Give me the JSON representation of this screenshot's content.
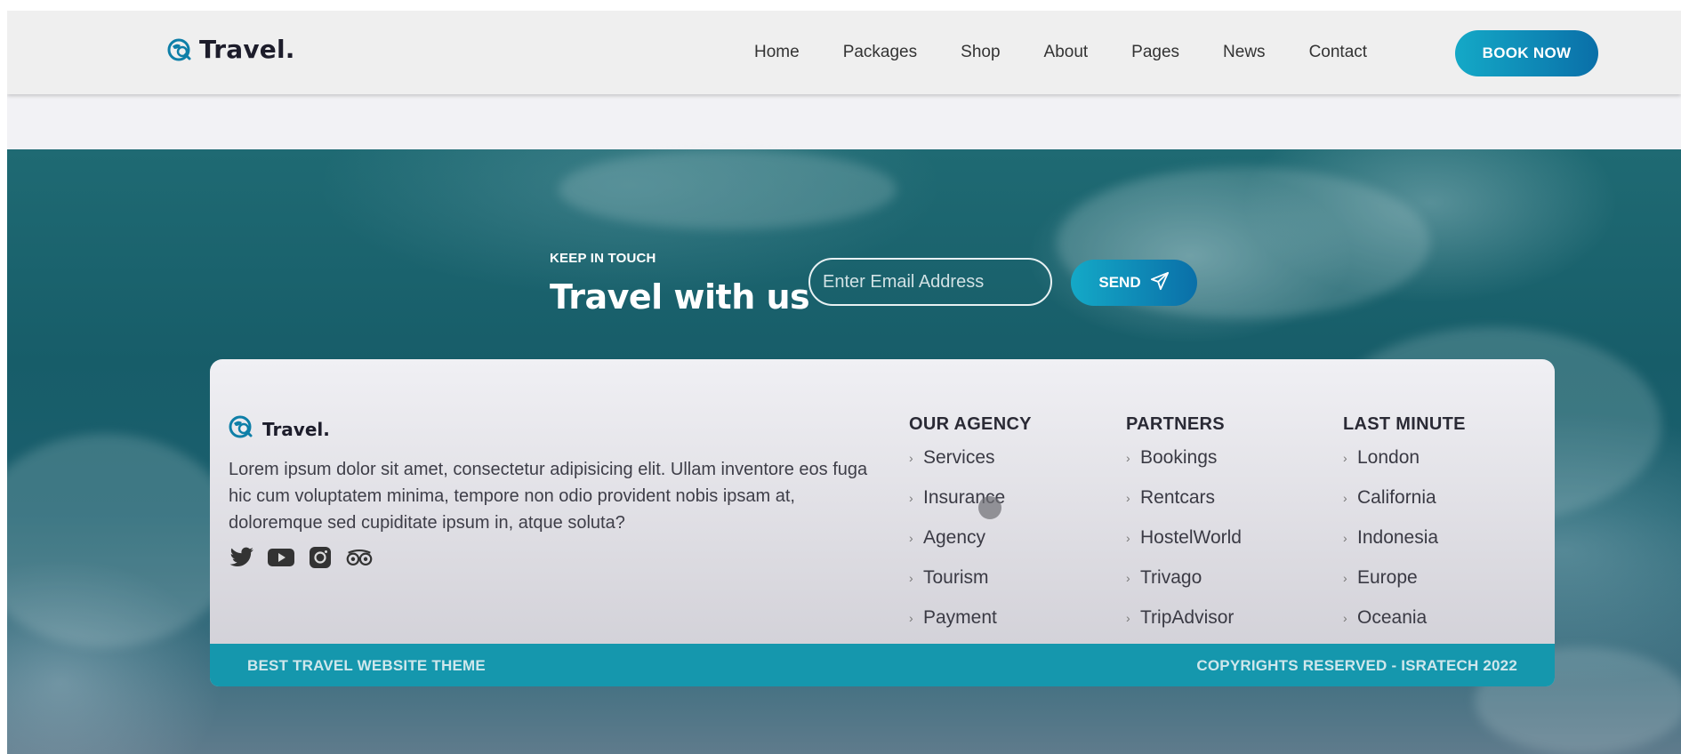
{
  "brand": {
    "name": "Travel."
  },
  "nav": {
    "links": [
      "Home",
      "Packages",
      "Shop",
      "About",
      "Pages",
      "News",
      "Contact"
    ],
    "cta": "BOOK NOW"
  },
  "newsletter": {
    "eyebrow": "KEEP IN TOUCH",
    "heading": "Travel with us",
    "email_placeholder": "Enter Email Address",
    "send_label": "SEND"
  },
  "footer": {
    "brand": "Travel.",
    "about": "Lorem ipsum dolor sit amet, consectetur adipisicing elit. Ullam inventore eos fuga hic cum voluptatem minima, tempore non odio provident nobis ipsam at, doloremque sed cupiditate ipsum in, atque soluta?",
    "social_icons": [
      "twitter-icon",
      "youtube-icon",
      "instagram-icon",
      "tripadvisor-icon"
    ],
    "columns": [
      {
        "title": "OUR AGENCY",
        "items": [
          "Services",
          "Insurance",
          "Agency",
          "Tourism",
          "Payment"
        ]
      },
      {
        "title": "PARTNERS",
        "items": [
          "Bookings",
          "Rentcars",
          "HostelWorld",
          "Trivago",
          "TripAdvisor"
        ]
      },
      {
        "title": "LAST MINUTE",
        "items": [
          "London",
          "California",
          "Indonesia",
          "Europe",
          "Oceania"
        ]
      }
    ],
    "bottom_left": "BEST TRAVEL WEBSITE THEME",
    "bottom_right": "COPYRIGHTS RESERVED - ISRATECH 2022"
  },
  "colors": {
    "accent": "#1597ad",
    "gradient_start": "#14a9c7",
    "gradient_end": "#0a6fa8"
  }
}
